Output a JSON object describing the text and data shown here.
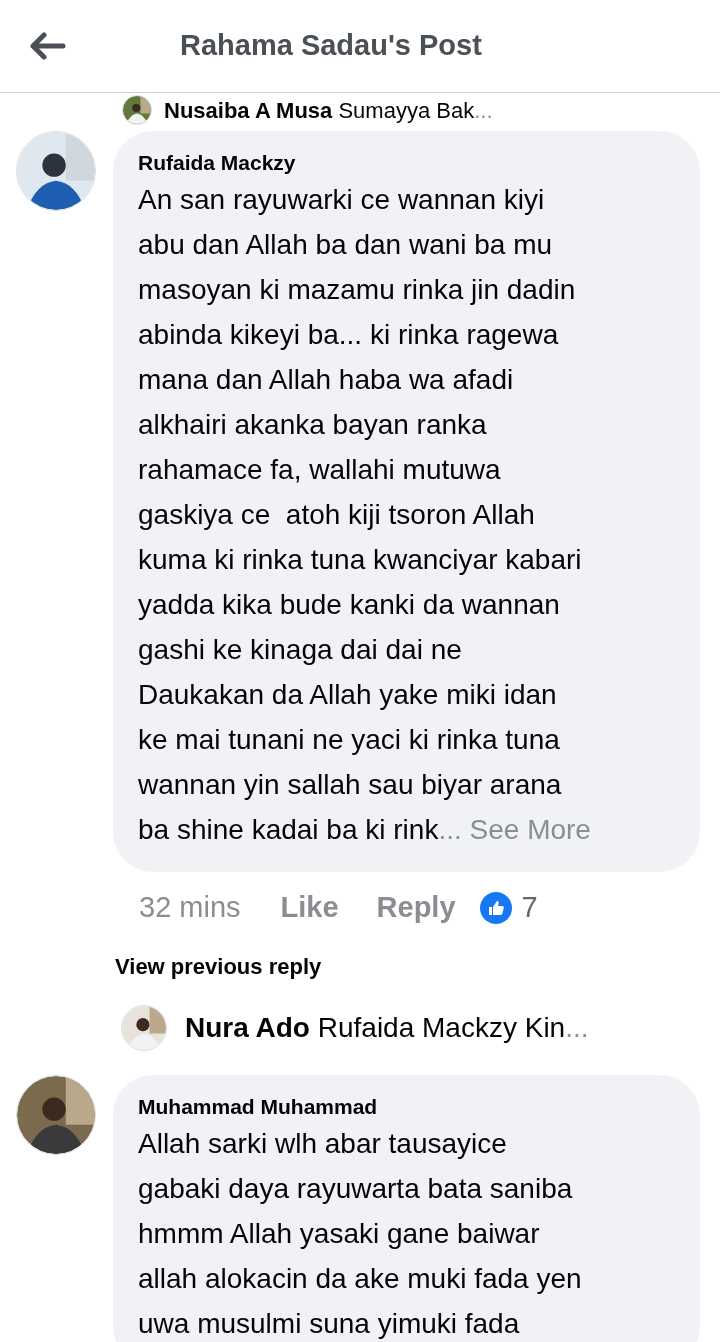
{
  "header": {
    "title": "Rahama Sadau's Post"
  },
  "previous_reply": {
    "author": "Nusaiba A Musa",
    "text": "Sumayya Bak",
    "ellipsis": "..."
  },
  "comments": [
    {
      "author": "Rufaida Mackzy",
      "body": "An san rayuwarki ce wannan kiyi\nabu dan Allah ba dan wani ba mu\nmasoyan ki mazamu rinka jin dadin\nabinda kikeyi ba... ki rinka ragewa\nmana dan Allah haba wa afadi\nalkhairi akanka bayan ranka\nrahamace fa, wallahi mutuwa\ngaskiya ce  atoh kiji tsoron Allah\nkuma ki rinka tuna kwanciyar kabari\nyadda kika bude kanki da wannan\ngashi ke kinaga dai dai ne\nDaukakan da Allah yake miki idan\nke mai tunani ne yaci ki rinka tuna\nwannan yin sallah sau biyar arana\nba shine kadai ba ki rink",
      "ellipsis": "...",
      "see_more": "See More",
      "time": "32 mins",
      "like": "Like",
      "reply": "Reply",
      "reactions": "7",
      "view_replies": "View previous reply",
      "replies": [
        {
          "author": "Nura Ado",
          "mention": "Rufaida Mackzy",
          "text": "Kin",
          "ellipsis": "..."
        }
      ]
    },
    {
      "author": "Muhammad Muhammad",
      "body": "Allah sarki wlh abar tausayice\ngabaki daya rayuwarta bata saniba\nhmmm Allah yasaki gane baiwar\nallah alokacin da ake muki fada yen\nuwa musulmi suna yimuki fada"
    }
  ]
}
